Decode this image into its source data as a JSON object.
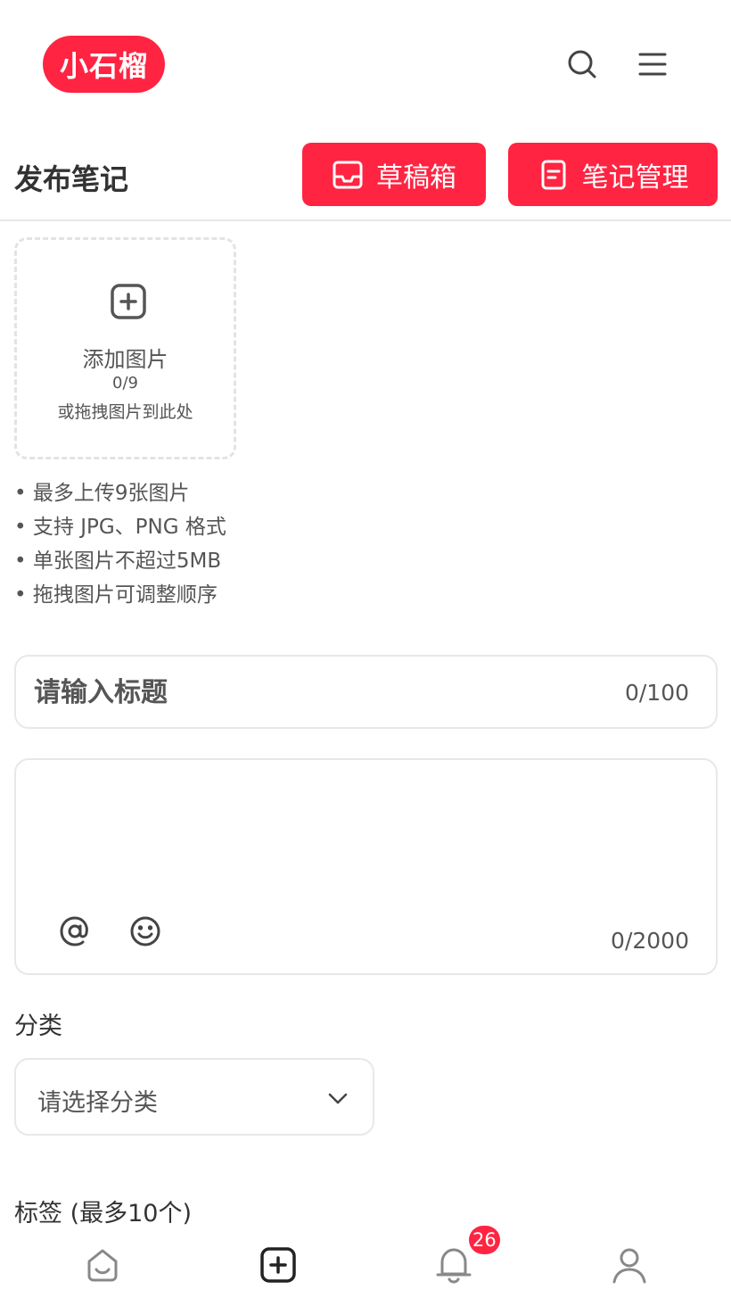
{
  "header": {
    "logo_text": "小石榴",
    "search_icon": "search-icon",
    "menu_icon": "menu-icon"
  },
  "toolbar": {
    "page_title": "发布笔记",
    "drafts_label": "草稿箱",
    "drafts_icon": "inbox-icon",
    "manage_label": "笔记管理",
    "manage_icon": "document-icon"
  },
  "upload": {
    "label": "添加图片",
    "count": "0/9",
    "drag_hint": "或拖拽图片到此处",
    "icon": "plus-square-icon"
  },
  "tips": [
    "最多上传9张图片",
    "支持 JPG、PNG 格式",
    "单张图片不超过5MB",
    "拖拽图片可调整顺序"
  ],
  "title_field": {
    "placeholder": "请输入标题",
    "value": "",
    "count": "0/100"
  },
  "content_field": {
    "placeholder": "",
    "value": "",
    "count": "0/2000",
    "mention_icon": "at-icon",
    "emoji_icon": "emoji-icon"
  },
  "category": {
    "label": "分类",
    "selected": "请选择分类",
    "icon": "chevron-down-icon"
  },
  "tags": {
    "label": "标签 (最多10个)"
  },
  "bottom_nav": {
    "items": [
      "home-icon",
      "publish-icon",
      "notification-icon",
      "profile-icon"
    ],
    "notification_badge": "26"
  },
  "colors": {
    "accent": "#ff2442",
    "text": "#333333",
    "muted": "#555555",
    "border": "#e8e8e8"
  }
}
